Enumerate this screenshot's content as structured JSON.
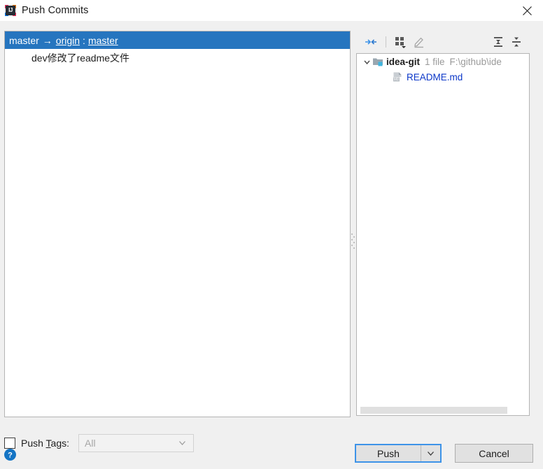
{
  "window": {
    "title": "Push Commits",
    "icon": "intellij-idea-icon",
    "icon_text": "IJ",
    "close_icon": "close-icon"
  },
  "commits_panel": {
    "branch_row": {
      "local_branch": "master",
      "arrow": "→",
      "remote": "origin",
      "separator": ":",
      "remote_branch": "master"
    },
    "commits": [
      {
        "message": "dev修改了readme文件"
      }
    ]
  },
  "changes_panel": {
    "toolbar": [
      {
        "name": "collapse-changes-icon",
        "tooltip": "Show Diff"
      },
      {
        "name": "group-by-icon",
        "tooltip": "Group By"
      },
      {
        "name": "edit-source-icon",
        "tooltip": "Edit Source"
      },
      {
        "name": "expand-all-icon",
        "tooltip": "Expand All"
      },
      {
        "name": "collapse-all-icon",
        "tooltip": "Collapse All"
      }
    ],
    "tree": {
      "root": {
        "expand_icon": "chevron-down-icon",
        "folder_icon": "module-folder-icon",
        "name": "idea-git",
        "count": "1 file",
        "path": "F:\\github\\ide"
      },
      "files": [
        {
          "icon": "markdown-file-icon",
          "icon_label": "MD",
          "name": "README.md"
        }
      ]
    }
  },
  "options": {
    "push_tags_checked": false,
    "push_tags_label_pre": "Push ",
    "push_tags_label_mnemonic": "T",
    "push_tags_label_post": "ags:",
    "push_tags_value": "All",
    "push_tags_options": [
      "All"
    ]
  },
  "footer": {
    "help_icon": "help-icon",
    "help_glyph": "?",
    "push_label": "Push",
    "push_dropdown_icon": "chevron-down-icon",
    "cancel_label": "Cancel"
  },
  "colors": {
    "selection_blue": "#2675bf",
    "link_blue": "#0a36c8",
    "focus_blue": "#3d93e8",
    "muted_gray": "#9a9a9a",
    "dialog_bg": "#f0f0f0"
  }
}
